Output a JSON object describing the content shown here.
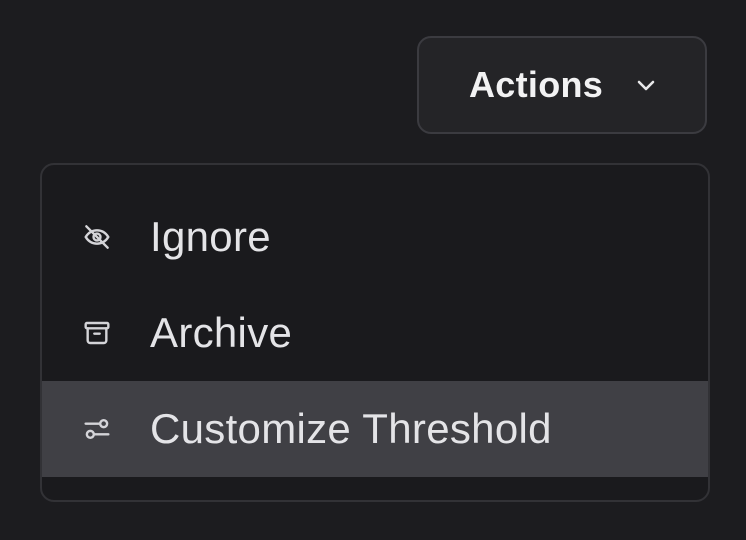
{
  "actions_button": {
    "label": "Actions",
    "icon": "chevron-down-icon"
  },
  "menu": {
    "items": [
      {
        "label": "Ignore",
        "icon": "eye-off-icon",
        "active": false
      },
      {
        "label": "Archive",
        "icon": "archive-icon",
        "active": false
      },
      {
        "label": "Customize Threshold",
        "icon": "sliders-icon",
        "active": true
      }
    ]
  },
  "colors": {
    "background": "#1c1c1f",
    "button_bg": "#242427",
    "menu_bg": "#1a1a1d",
    "active_item_bg": "#404045",
    "text_primary": "#e4e4e7"
  }
}
